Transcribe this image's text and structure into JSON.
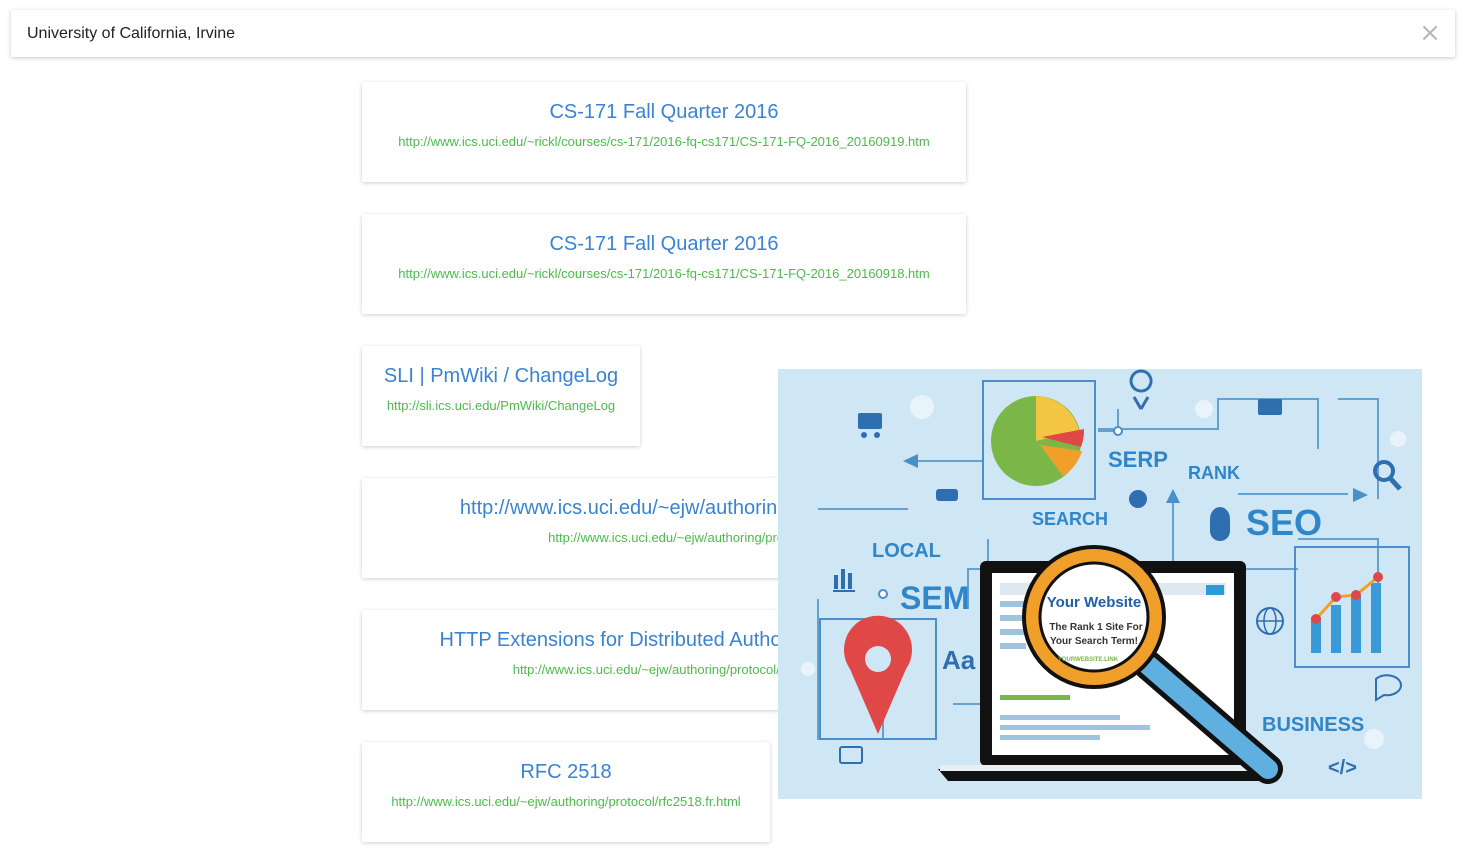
{
  "search": {
    "value": "University of California, Irvine",
    "close_icon": "close-icon"
  },
  "results": [
    {
      "title": "CS-171 Fall Quarter 2016",
      "url": "http://www.ics.uci.edu/~rickl/courses/cs-171/2016-fq-cs171/CS-171-FQ-2016_20160919.htm"
    },
    {
      "title": "CS-171 Fall Quarter 2016",
      "url": "http://www.ics.uci.edu/~rickl/courses/cs-171/2016-fq-cs171/CS-171-FQ-2016_20160918.htm"
    },
    {
      "title": "SLI | PmWiki / ChangeLog",
      "url": "http://sli.ics.uci.edu/PmWiki/ChangeLog"
    },
    {
      "title": "http://www.ics.uci.edu/~ejw/authoring/protocol/rfc2518.txt",
      "url": "http://www.ics.uci.edu/~ejw/authoring/protocol/rfc2518.txt"
    },
    {
      "title": "HTTP Extensions for Distributed Authoring -- WEBDAV",
      "url": "http://www.ics.uci.edu/~ejw/authoring/protocol/rfc2518.html"
    },
    {
      "title": "RFC 2518",
      "url": "http://www.ics.uci.edu/~ejw/authoring/protocol/rfc2518.fr.html"
    }
  ],
  "overlay_image": {
    "labels": {
      "serp": "SERP",
      "rank": "RANK",
      "search": "SEARCH",
      "seo": "SEO",
      "local": "LOCAL",
      "sem": "SEM",
      "business": "BUSINESS",
      "aa": "Aa",
      "your_website": "Your Website",
      "rank1_line1": "The Rank 1 Site For",
      "rank1_line2": "Your Search Term!",
      "your_website_link": "YOURWEBSITE.LINK",
      "code": "</>"
    },
    "colors": {
      "background": "#cfe6f4",
      "accent_blue": "#2f86c9",
      "pin_red": "#e04848",
      "magnifier_orange": "#f0a02a",
      "pie_green": "#7ab648",
      "pie_yellow": "#f4c542"
    }
  }
}
